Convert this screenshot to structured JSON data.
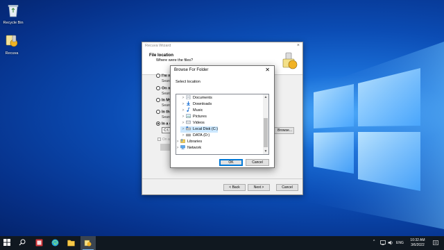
{
  "desktop": {
    "icons": [
      {
        "label": "Recycle Bin"
      },
      {
        "label": "Recuva"
      }
    ]
  },
  "wizard": {
    "title": "Recuva Wizard",
    "heading": "File location",
    "subheading": "Where were the files?",
    "options": [
      {
        "label": "I'm n",
        "sub": "Search"
      },
      {
        "label": "On m",
        "sub": "Search"
      },
      {
        "label": "In My",
        "sub": "Search"
      },
      {
        "label": "In th",
        "sub": "Search"
      },
      {
        "label": "In a s",
        "sub": ""
      }
    ],
    "path_value": "C:\\",
    "browse_label": "Browse...",
    "checkbox_label": "On a",
    "back_label": "< Back",
    "next_label": "Next >",
    "cancel_label": "Cancel"
  },
  "browse_dialog": {
    "title": "Browse For Folder",
    "close_glyph": "✕",
    "prompt": "Select location",
    "tree": [
      {
        "label": "Documents",
        "icon": "documents-icon"
      },
      {
        "label": "Downloads",
        "icon": "downloads-icon"
      },
      {
        "label": "Music",
        "icon": "music-icon"
      },
      {
        "label": "Pictures",
        "icon": "pictures-icon"
      },
      {
        "label": "Videos",
        "icon": "videos-icon"
      },
      {
        "label": "Local Disk (C:)",
        "icon": "drive-icon",
        "selected": true
      },
      {
        "label": "DATA (D:)",
        "icon": "drive-icon"
      },
      {
        "label": "Libraries",
        "icon": "libraries-icon"
      },
      {
        "label": "Network",
        "icon": "network-icon"
      }
    ],
    "ok_label": "OK",
    "cancel_label": "Cancel"
  },
  "taskbar": {
    "language": "ENG",
    "time": "10:32 AM",
    "date": "3/6/2022",
    "tray_chevron": "^"
  }
}
